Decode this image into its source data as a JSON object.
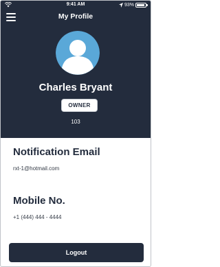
{
  "status_bar": {
    "time": "9:41 AM",
    "battery_percent": "93%",
    "battery_level": 0.93,
    "icons": [
      "wifi-icon",
      "location-icon",
      "battery-icon"
    ]
  },
  "header": {
    "title": "My Profile",
    "menu_icon": "hamburger-menu-icon"
  },
  "profile": {
    "name": "Charles Bryant",
    "role": "OWNER",
    "number": "103",
    "avatar_icon": "user-silhouette-icon"
  },
  "details": {
    "email_heading": "Notification Email",
    "email_value": "rxt-1@hotmail.com",
    "mobile_heading": "Mobile No.",
    "mobile_value": "+1 (444) 444 - 4444"
  },
  "actions": {
    "logout_label": "Logout"
  },
  "colors": {
    "header_bg": "#232c3d",
    "avatar_bg": "#5aa8d8",
    "text_dark": "#232c3d",
    "white": "#ffffff"
  }
}
